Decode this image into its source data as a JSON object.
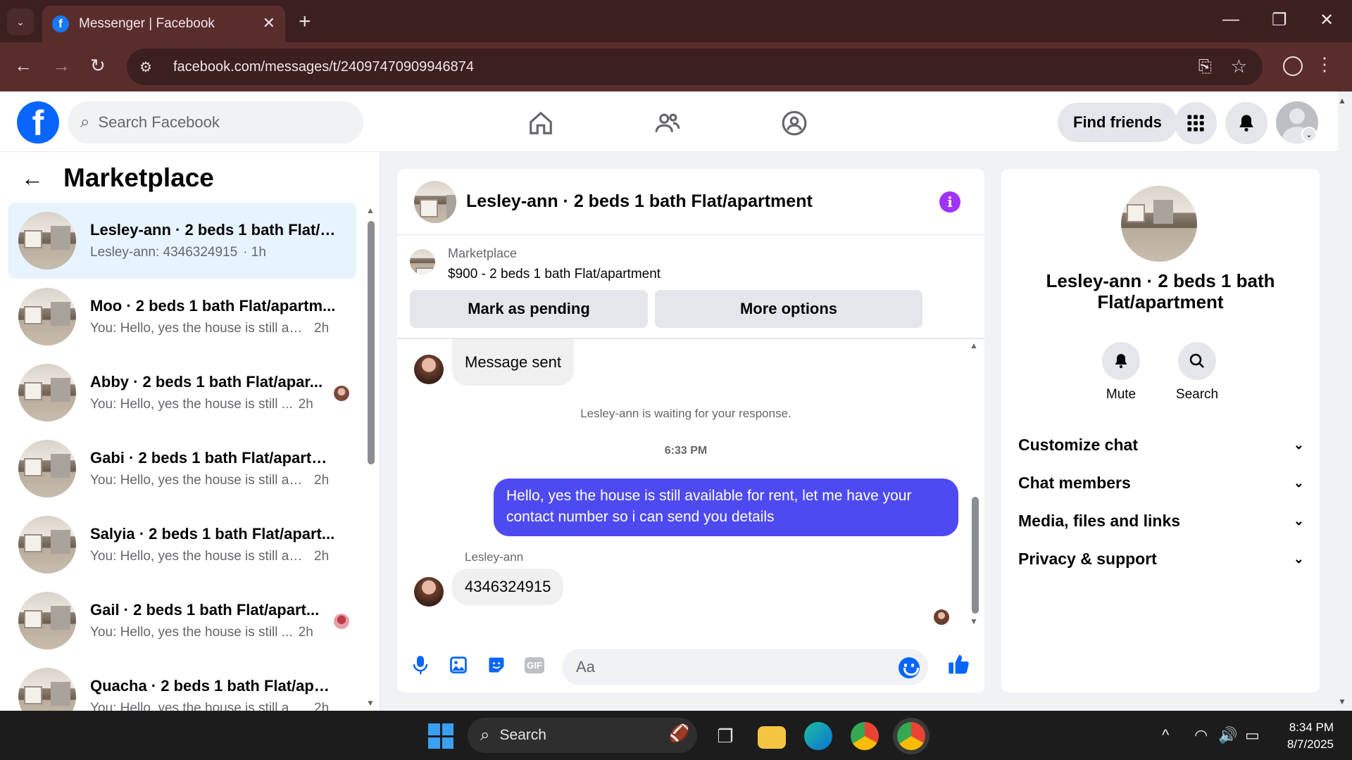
{
  "browser": {
    "tab_title": "Messenger | Facebook",
    "url": "facebook.com/messages/t/24097470909946874"
  },
  "header": {
    "search_placeholder": "Search Facebook",
    "find_friends": "Find friends"
  },
  "sidebar": {
    "title": "Marketplace",
    "conversations": [
      {
        "name": "Lesley-ann · 2 beds 1 bath Flat/a...",
        "preview": "Lesley-ann: 4346324915",
        "time": "· 1h"
      },
      {
        "name": "Moo · 2 beds 1 bath Flat/apartm...",
        "preview": "You: Hello, yes the house is still ava...",
        "time": "2h"
      },
      {
        "name": "Abby · 2 beds 1 bath Flat/apar...",
        "preview": "You: Hello, yes the house is still ...",
        "time": "2h"
      },
      {
        "name": "Gabi · 2 beds 1 bath Flat/apartm...",
        "preview": "You: Hello, yes the house is still ava...",
        "time": "2h"
      },
      {
        "name": "Salyia · 2 beds 1 bath Flat/apart...",
        "preview": "You: Hello, yes the house is still ava...",
        "time": "2h"
      },
      {
        "name": "Gail · 2 beds 1 bath Flat/apart...",
        "preview": "You: Hello, yes the house is still ...",
        "time": "2h"
      },
      {
        "name": "Quacha · 2 beds 1 bath Flat/apar...",
        "preview": "You: Hello, yes the house is still ava...",
        "time": "2h"
      }
    ]
  },
  "chat": {
    "title": "Lesley-ann · 2 beds 1 bath Flat/apartment",
    "listing_source": "Marketplace",
    "listing_title": "$900 - 2 beds 1 bath Flat/apartment",
    "mark_pending": "Mark as pending",
    "more_options": "More options",
    "msg_sent": "Message sent",
    "waiting_note": "Lesley-ann is waiting for your response.",
    "timestamp": "6:33 PM",
    "outgoing": "Hello, yes the house is still available for rent, let me have your contact number so i can send you details",
    "sender_name": "Lesley-ann",
    "incoming": "4346324915",
    "input_placeholder": "Aa",
    "gif_label": "GIF"
  },
  "details": {
    "name": "Lesley-ann · 2 beds 1 bath Flat/apartment",
    "mute": "Mute",
    "search": "Search",
    "sections": [
      "Customize chat",
      "Chat members",
      "Media, files and links",
      "Privacy & support"
    ]
  },
  "taskbar": {
    "search_label": "Search",
    "time": "8:34 PM",
    "date": "8/7/2025"
  },
  "colors": {
    "facebook_blue": "#0866ff",
    "outgoing_bubble": "#4e4af2",
    "active_conversation": "#e7f3ff",
    "browser_frame": "#5a2d2d"
  }
}
